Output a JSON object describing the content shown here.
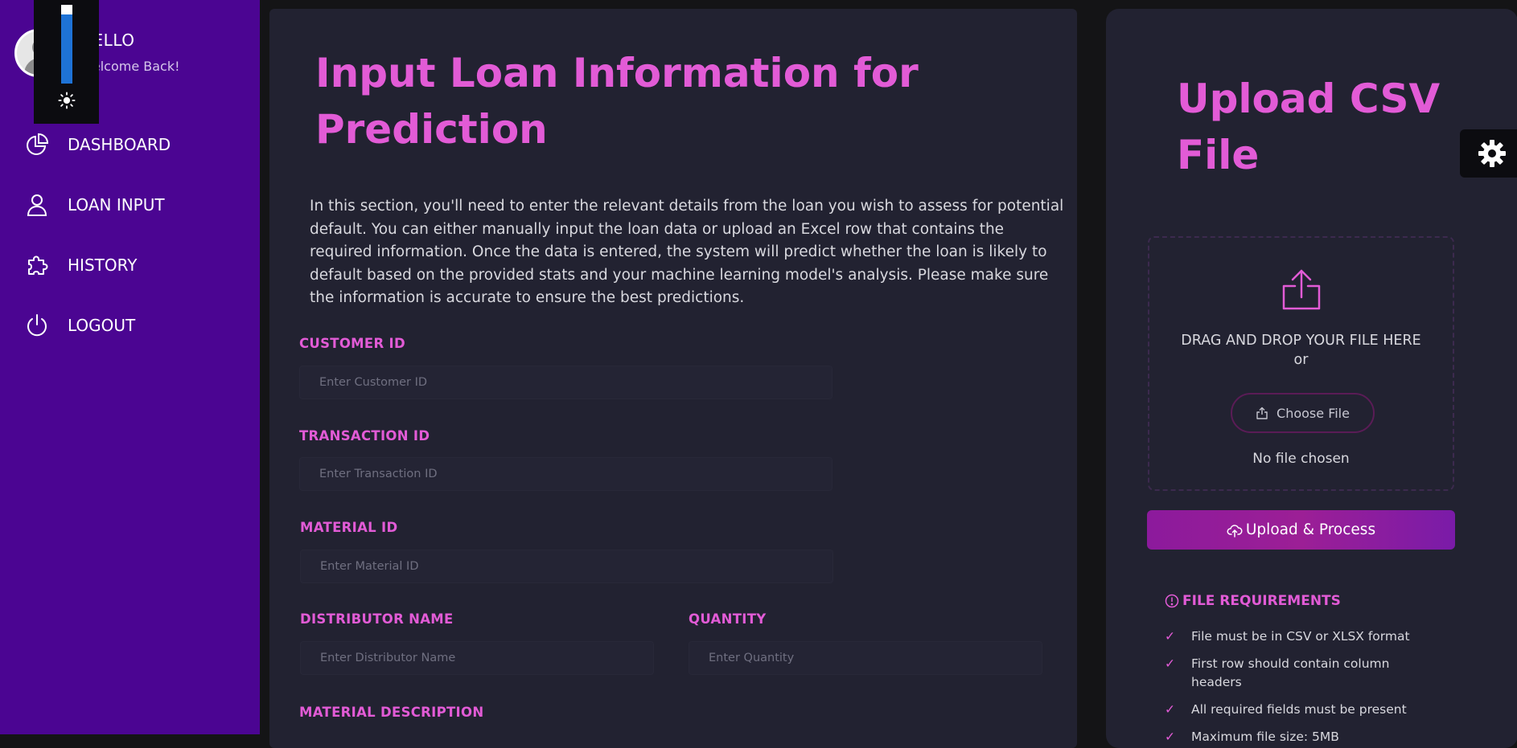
{
  "user": {
    "greeting": "HELLO",
    "subgreeting": "Welcome Back!"
  },
  "brightness": {
    "level": 0.9
  },
  "sidebar": {
    "items": [
      {
        "label": "DASHBOARD",
        "icon": "pie-chart-icon"
      },
      {
        "label": "LOAN INPUT",
        "icon": "user-icon"
      },
      {
        "label": "HISTORY",
        "icon": "puzzle-icon"
      },
      {
        "label": "LOGOUT",
        "icon": "power-icon"
      }
    ]
  },
  "main": {
    "title": "Input Loan Information for Prediction",
    "description": "In this section, you'll need to enter the relevant details from the loan you wish to assess for potential default. You can either manually input the loan data or upload an Excel row that contains the required information. Once the data is entered, the system will predict whether the loan is likely to default based on the provided stats and your machine learning model's analysis. Please make sure the information is accurate to ensure the best predictions.",
    "fields": {
      "customer_id": {
        "label": "CUSTOMER ID",
        "placeholder": "Enter Customer ID"
      },
      "transaction_id": {
        "label": "TRANSACTION ID",
        "placeholder": "Enter Transaction ID"
      },
      "material_id": {
        "label": "MATERIAL ID",
        "placeholder": "Enter Material ID"
      },
      "distributor_name": {
        "label": "DISTRIBUTOR NAME",
        "placeholder": "Enter Distributor Name"
      },
      "quantity": {
        "label": "QUANTITY",
        "placeholder": "Enter Quantity"
      },
      "material_description": {
        "label": "MATERIAL DESCRIPTION"
      }
    }
  },
  "upload": {
    "title": "Upload CSV File",
    "drag_text": "DRAG AND DROP YOUR FILE HERE",
    "or_text": "or",
    "choose_label": "Choose File",
    "no_file": "No file chosen",
    "process_label": "Upload & Process",
    "requirements_title": "FILE REQUIREMENTS",
    "check_mark": "✓",
    "requirements": [
      "File must be in CSV or XLSX format",
      "First row should contain column headers",
      "All required fields must be present",
      "Maximum file size: 5MB"
    ]
  },
  "colors": {
    "sidebar": "#4b0592",
    "accent": "#e25bd6",
    "panel": "#222231",
    "background": "#141416"
  }
}
